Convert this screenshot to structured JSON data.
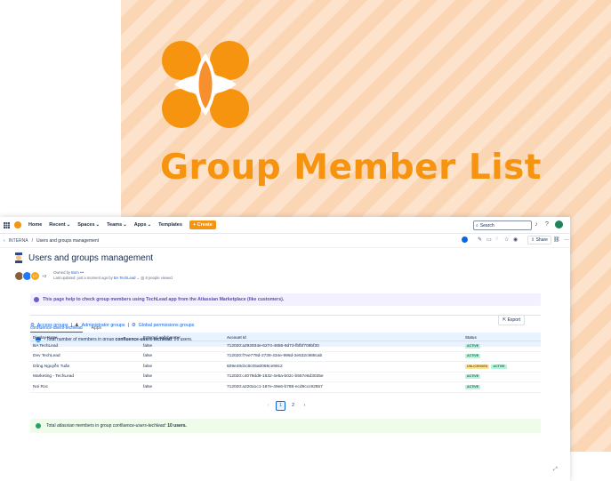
{
  "promo": {
    "title": "Group Member List",
    "logo_icon": "orange-flower-logo"
  },
  "nav": {
    "items": [
      "Home",
      "Recent",
      "Spaces",
      "Teams",
      "Apps",
      "Templates"
    ],
    "create_label": "Create",
    "search_placeholder": "Search"
  },
  "breadcrumb": {
    "space": "INTERNA",
    "current": "Users and groups management"
  },
  "toolbar": {
    "share_label": "Share"
  },
  "page": {
    "title": "Users and groups management",
    "owner_prefix": "Owned by",
    "owner": "Bom",
    "updated_prefix": "Last updated: just a moment ago by",
    "updated_by": "BA TechLead",
    "viewed": "8 people viewed",
    "avatar_extra": "+2",
    "avatar_initials": "DT"
  },
  "panel_info": "This page help to check group members using TechLead app from the Atlassian Marketplace (like customers).",
  "links": {
    "access": "Access groups",
    "admin": "Administrator groups",
    "global": "Global permissions groups"
  },
  "summary": {
    "prefix": "Total number of members in group",
    "group": "confluence-users-techlead",
    "suffix": ": 26 users."
  },
  "export_label": "Export",
  "tabs": {
    "active": "confluence-users-techlead",
    "other": "Apps"
  },
  "table": {
    "headers": [
      "Display Name",
      "External collaborator",
      "Account Id",
      "Status"
    ],
    "rows": [
      {
        "name": "BA TechLead",
        "external": "false",
        "id": "712020:a292934e-6274-4656-9d73-fbfbf709bf30",
        "status": [
          "ACTIVE"
        ]
      },
      {
        "name": "Dev TechLead",
        "external": "false",
        "id": "712020:f7ee778d-2738-434e-996d-2e532c988cab",
        "status": [
          "ACTIVE"
        ]
      },
      {
        "name": "Dũng Nguyễn Tuấn",
        "external": "false",
        "id": "609e48cbc8c05a0069ce98c2",
        "status": [
          "UNLICENSED",
          "ACTIVE"
        ]
      },
      {
        "name": "Marketing - TechLead",
        "external": "false",
        "id": "712020:c4079dd9-1632-4e5a-b02c-b557e6d3035e",
        "status": [
          "ACTIVE"
        ]
      },
      {
        "name": "Noi Roc",
        "external": "false",
        "id": "712020:a220a1c1-187e-49e6-b788-ecd9ccc92557",
        "status": [
          "ACTIVE"
        ]
      }
    ]
  },
  "pager": {
    "prev": "‹",
    "pages": [
      "1",
      "2"
    ],
    "next": "›",
    "current": "1"
  },
  "footer": {
    "prefix": "Total",
    "italic": "atlassian",
    "middle": "members in group",
    "group": "confluence-users-techlead",
    "suffix": "10 users."
  },
  "colors": {
    "brand": "#f6930f",
    "link": "#0c66e4",
    "info_bg": "#e9f2ff",
    "success_bg": "#effce9",
    "purple_bg": "#f3f0ff"
  }
}
